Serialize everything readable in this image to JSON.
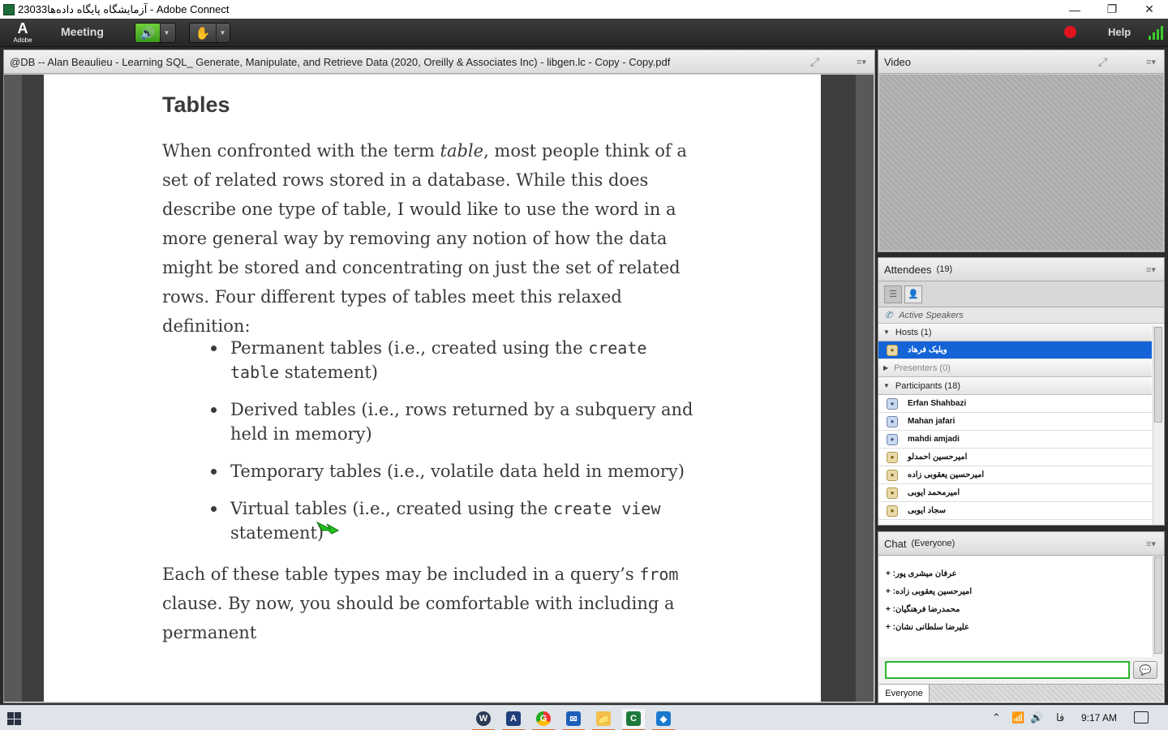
{
  "window": {
    "title": "آزمایشگاه پایگاه داده‌ها23033 - Adobe Connect",
    "minimize": "—",
    "restore": "❐",
    "close": "✕"
  },
  "menubar": {
    "adobe_logo": "A",
    "adobe_label": "Adobe",
    "meeting": "Meeting",
    "help": "Help",
    "speaker_icon": "🔊",
    "camera_icon": "✋",
    "record_color": "#e0141e"
  },
  "share_pod": {
    "title": "@DB -- Alan Beaulieu - Learning SQL_ Generate, Manipulate, and Retrieve Data (2020, Oreilly & Associates Inc) - libgen.lc - Copy - Copy.pdf",
    "page": {
      "heading": "Tables",
      "para1_a": "When confronted with the term ",
      "para1_em": "table",
      "para1_b": ", most people think of a set of related rows stored in a database. While this does describe one type of table, I would like to use the word in a more general way by removing any notion of how the data might be stored and concentrating on just the set of related rows. Four different types of tables meet this relaxed definition:",
      "bullets": [
        {
          "a": "Permanent tables (i.e., created using the ",
          "code": "create table",
          "b": " statement)"
        },
        {
          "a": "Derived tables (i.e., rows returned by a subquery and held in memory)",
          "code": "",
          "b": ""
        },
        {
          "a": "Temporary tables (i.e., volatile data held in memory)",
          "code": "",
          "b": ""
        },
        {
          "a": "Virtual tables (i.e., created using the ",
          "code": "create view",
          "b": " statement)"
        }
      ],
      "para2_a": "Each of these table types may be included in a query’s ",
      "para2_code": "from",
      "para2_b": " clause. By now, you should be comfortable with including a permanent"
    }
  },
  "video_pod": {
    "title": "Video"
  },
  "attendees_pod": {
    "title": "Attendees",
    "count": "(19)",
    "active_speakers": "Active Speakers",
    "hosts_label": "Hosts (1)",
    "presenters_label": "Presenters (0)",
    "participants_label": "Participants (18)",
    "hosts": [
      "ویلیک فرهاد"
    ],
    "participants": [
      "Erfan Shahbazi",
      "Mahan jafari",
      "mahdi amjadi",
      "امیرحسین احمدلو",
      "امیرحسین یعقوبی زاده",
      "امیرمحمد ایوبی",
      "سجاد ایوبی"
    ]
  },
  "chat_pod": {
    "title": "Chat",
    "scope": "(Everyone)",
    "messages": [
      "+ :عرفان میشری پور",
      "+ :امیرحسین یعقوبی زاده",
      "+ :محمدرضا فرهنگیان",
      "+ :علیرضا سلطانی نشان"
    ],
    "tab": "Everyone",
    "send_icon": "💬"
  },
  "taskbar": {
    "time": "9:17 AM",
    "lang": "فا",
    "apps": [
      "W",
      "A",
      "G",
      "✉",
      "📁",
      "C",
      "◆"
    ]
  }
}
